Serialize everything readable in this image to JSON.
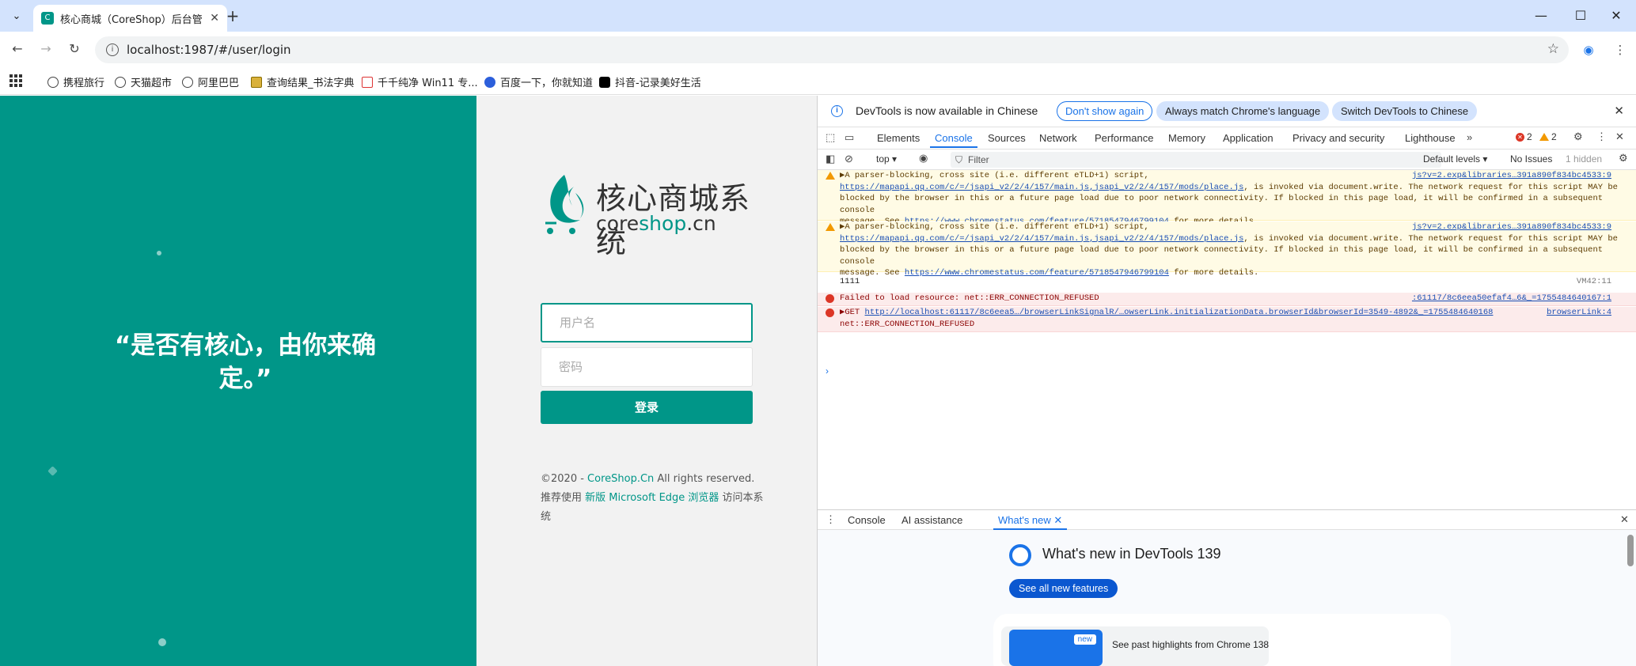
{
  "browser": {
    "tab_title": "核心商城（CoreShop）后台管",
    "url": "localhost:1987/#/user/login",
    "bookmarks": [
      "携程旅行",
      "天猫超市",
      "阿里巴巴",
      "查询结果_书法字典",
      "千千纯净 Win11 专...",
      "百度一下，你就知道",
      "抖音-记录美好生活"
    ]
  },
  "login": {
    "slogan": "“是否有核心，由你来确定。”",
    "logo_cn": "核心商城系统",
    "logo_en_a": "core",
    "logo_en_b": "shop",
    "logo_en_c": ".cn",
    "username_placeholder": "用户名",
    "password_placeholder": "密码",
    "login_button": "登录",
    "copyright_prefix": "©2020 - ",
    "copyright_link": "CoreShop.Cn",
    "copyright_suffix": " All rights reserved.",
    "recommend_prefix": "推荐使用 ",
    "recommend_link": "新版 Microsoft Edge 浏览器",
    "recommend_suffix": " 访问本系统",
    "accent_color": "#009688"
  },
  "devtools": {
    "info_message": "DevTools is now available in Chinese",
    "btn_dont_show": "Don't show again",
    "btn_match": "Always match Chrome's language",
    "btn_switch": "Switch DevTools to Chinese",
    "tabs": [
      "Elements",
      "Console",
      "Sources",
      "Network",
      "Performance",
      "Memory",
      "Application",
      "Privacy and security",
      "Lighthouse"
    ],
    "error_count": "2",
    "warning_count": "2",
    "context": "top",
    "filter_placeholder": "Filter",
    "levels": "Default levels",
    "issues": "No Issues",
    "hidden": "1 hidden",
    "messages": [
      {
        "line1": "▶A parser-blocking, cross site (i.e. different eTLD+1) script,",
        "link": "https://mapapi.qq.com/c/=/jsapi_v2/2/4/157/main.js,jsapi_v2/2/4/157/mods/place.js",
        "line2": ", is invoked via document.write. The network request for this script MAY be",
        "line3": "blocked by the browser in this or a future page load due to poor network connectivity. If blocked in this page load, it will be confirmed in a subsequent console",
        "line4a": "message. See ",
        "link2": "https://www.chromestatus.com/feature/5718547946799104",
        "line4b": " for more details.",
        "source": "js?v=2.exp&libraries…391a890f834bc4533:9"
      },
      {
        "line1": "▶A parser-blocking, cross site (i.e. different eTLD+1) script,",
        "link": "https://mapapi.qq.com/c/=/jsapi_v2/2/4/157/main.js,jsapi_v2/2/4/157/mods/place.js",
        "line2": ", is invoked via document.write. The network request for this script MAY be",
        "line3": "blocked by the browser in this or a future page load due to poor network connectivity. If blocked in this page load, it will be confirmed in a subsequent console",
        "line4a": "message. See ",
        "link2": "https://www.chromestatus.com/feature/5718547946799104",
        "line4b": " for more details.",
        "source": "js?v=2.exp&libraries…391a890f834bc4533:9"
      }
    ],
    "log_text": "1111",
    "log_source": "VM42:11",
    "err1_text": "Failed to load resource: net::ERR_CONNECTION_REFUSED",
    "err1_source": ":61117/8c6eea50efaf4…6&_=1755484640167:1",
    "err2_prefix": "▶GET ",
    "err2_link": "http://localhost:61117/8c6eea5…/browserLinkSignalR/…owserLink.initializationData.browserId&browserId=3549-4892&_=1755484640168",
    "err2_line2": "net::ERR_CONNECTION_REFUSED",
    "err2_source": "browserLink:4",
    "drawer_tabs": [
      "Console",
      "AI assistance",
      "What's new"
    ],
    "whatsnew_title": "What's new in DevTools 139",
    "whatsnew_button": "See all new features",
    "whatsnew_badge": "new",
    "whatsnew_item": "See past highlights from Chrome 138"
  }
}
